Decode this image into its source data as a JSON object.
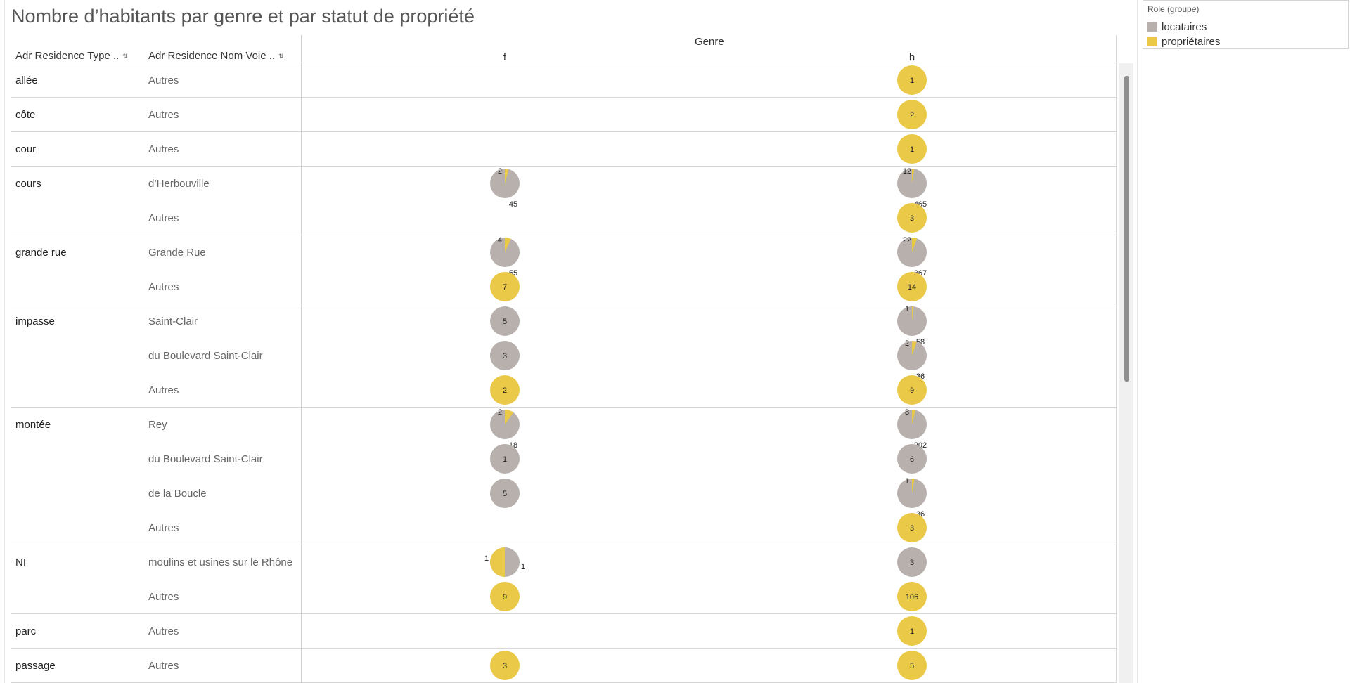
{
  "title": "Nombre d’habitants par genre et par statut de propriété",
  "header": {
    "col1_label": "Adr Residence Type ..",
    "col2_label": "Adr Residence Nom Voie ..",
    "genre_label": "Genre",
    "sort_icon": "sort-ascending-icon"
  },
  "colors": {
    "locataires": "#b8b0ad",
    "proprietaires": "#ebc948"
  },
  "legend": {
    "title": "Role (groupe)",
    "items": [
      {
        "label": "locataires",
        "color": "#b8b0ad"
      },
      {
        "label": "propriétaires",
        "color": "#ebc948"
      }
    ]
  },
  "chart_data": {
    "type": "pie",
    "x_field": "Genre",
    "columns": [
      "f",
      "h"
    ],
    "legend_title": "Role (groupe)",
    "series": [
      "locataires",
      "propriétaires"
    ],
    "groups": [
      {
        "type": "allée",
        "rows": [
          {
            "voie": "Autres",
            "f": null,
            "h": {
              "locataires": 0,
              "proprietaires": 1
            }
          }
        ]
      },
      {
        "type": "côte",
        "rows": [
          {
            "voie": "Autres",
            "f": null,
            "h": {
              "locataires": 0,
              "proprietaires": 2
            }
          }
        ]
      },
      {
        "type": "cour",
        "rows": [
          {
            "voie": "Autres",
            "f": null,
            "h": {
              "locataires": 0,
              "proprietaires": 1
            }
          }
        ]
      },
      {
        "type": "cours",
        "rows": [
          {
            "voie": "d’Herbouville",
            "f": {
              "locataires": 45,
              "proprietaires": 2
            },
            "h": {
              "locataires": 465,
              "proprietaires": 12
            }
          },
          {
            "voie": "Autres",
            "f": null,
            "h": {
              "locataires": 0,
              "proprietaires": 3
            }
          }
        ]
      },
      {
        "type": "grande rue",
        "rows": [
          {
            "voie": "Grande Rue",
            "f": {
              "locataires": 55,
              "proprietaires": 4
            },
            "h": {
              "locataires": 367,
              "proprietaires": 22
            }
          },
          {
            "voie": "Autres",
            "f": {
              "locataires": 0,
              "proprietaires": 7
            },
            "h": {
              "locataires": 0,
              "proprietaires": 14
            }
          }
        ]
      },
      {
        "type": "impasse",
        "rows": [
          {
            "voie": "Saint-Clair",
            "f": {
              "locataires": 5,
              "proprietaires": 0
            },
            "h": {
              "locataires": 58,
              "proprietaires": 1
            }
          },
          {
            "voie": "du Boulevard Saint-Clair",
            "f": {
              "locataires": 3,
              "proprietaires": 0
            },
            "h": {
              "locataires": 36,
              "proprietaires": 2
            }
          },
          {
            "voie": "Autres",
            "f": {
              "locataires": 0,
              "proprietaires": 2
            },
            "h": {
              "locataires": 0,
              "proprietaires": 9
            }
          }
        ]
      },
      {
        "type": "montée",
        "rows": [
          {
            "voie": "Rey",
            "f": {
              "locataires": 18,
              "proprietaires": 2
            },
            "h": {
              "locataires": 202,
              "proprietaires": 8
            }
          },
          {
            "voie": "du Boulevard Saint-Clair",
            "f": {
              "locataires": 1,
              "proprietaires": 0
            },
            "h": {
              "locataires": 6,
              "proprietaires": 0
            }
          },
          {
            "voie": "de la Boucle",
            "f": {
              "locataires": 5,
              "proprietaires": 0
            },
            "h": {
              "locataires": 36,
              "proprietaires": 1
            }
          },
          {
            "voie": "Autres",
            "f": null,
            "h": {
              "locataires": 0,
              "proprietaires": 3
            }
          }
        ]
      },
      {
        "type": "NI",
        "rows": [
          {
            "voie": "moulins et usines sur le Rhône",
            "f": {
              "locataires": 1,
              "proprietaires": 1
            },
            "h": {
              "locataires": 3,
              "proprietaires": 0
            }
          },
          {
            "voie": "Autres",
            "f": {
              "locataires": 0,
              "proprietaires": 9
            },
            "h": {
              "locataires": 0,
              "proprietaires": 106
            }
          }
        ]
      },
      {
        "type": "parc",
        "rows": [
          {
            "voie": "Autres",
            "f": null,
            "h": {
              "locataires": 0,
              "proprietaires": 1
            }
          }
        ]
      },
      {
        "type": "passage",
        "rows": [
          {
            "voie": "Autres",
            "f": {
              "locataires": 0,
              "proprietaires": 3
            },
            "h": {
              "locataires": 0,
              "proprietaires": 5
            }
          }
        ]
      }
    ]
  }
}
